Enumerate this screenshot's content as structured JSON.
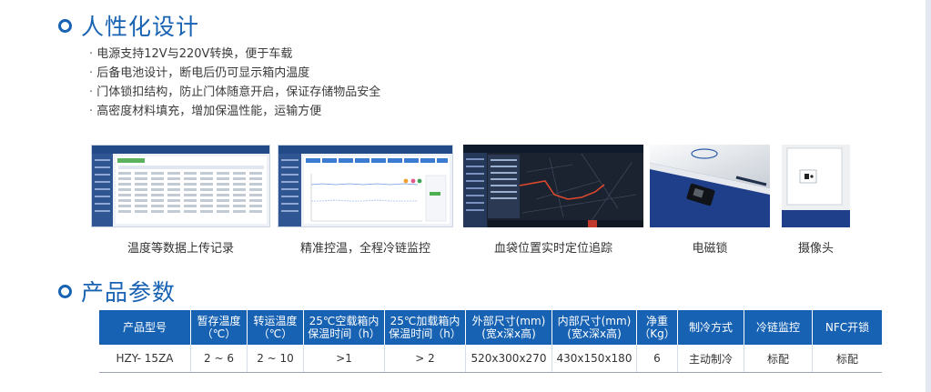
{
  "design": {
    "title": "人性化设计",
    "bullets": [
      "电源支持12V与220V转换，便于车载",
      "后备电池设计，断电后仍可显示箱内温度",
      "门体锁扣结构，防止门体随意开启，保证存储物品安全",
      "高密度材料填充，增加保温性能，运输方便"
    ],
    "captions": [
      "温度等数据上传记录",
      "精准控温，全程冷链监控",
      "血袋位置实时定位追踪",
      "电磁锁",
      "摄像头"
    ]
  },
  "params": {
    "title": "产品参数",
    "headers": [
      {
        "l1": "产品型号",
        "l2": ""
      },
      {
        "l1": "暂存温度",
        "l2": "（℃）"
      },
      {
        "l1": "转运温度",
        "l2": "（℃）"
      },
      {
        "l1": "25℃空载箱内",
        "l2": "保温时间（h）"
      },
      {
        "l1": "25℃加载箱内",
        "l2": "保温时间（h）"
      },
      {
        "l1": "外部尺寸(mm)",
        "l2": "(宽x深x高)"
      },
      {
        "l1": "内部尺寸(mm)",
        "l2": "(宽x深x高)"
      },
      {
        "l1": "净重",
        "l2": "（Kg）"
      },
      {
        "l1": "制冷方式",
        "l2": ""
      },
      {
        "l1": "冷链监控",
        "l2": ""
      },
      {
        "l1": "NFC开锁",
        "l2": ""
      }
    ],
    "row": [
      "HZY- 15ZA",
      "2 ~ 6",
      "2 ~ 10",
      ">1",
      "> 2",
      "520x300x270",
      "430x150x180",
      "6",
      "主动制冷",
      "标配",
      "标配"
    ]
  },
  "colors": {
    "accent": "#1762b3"
  }
}
